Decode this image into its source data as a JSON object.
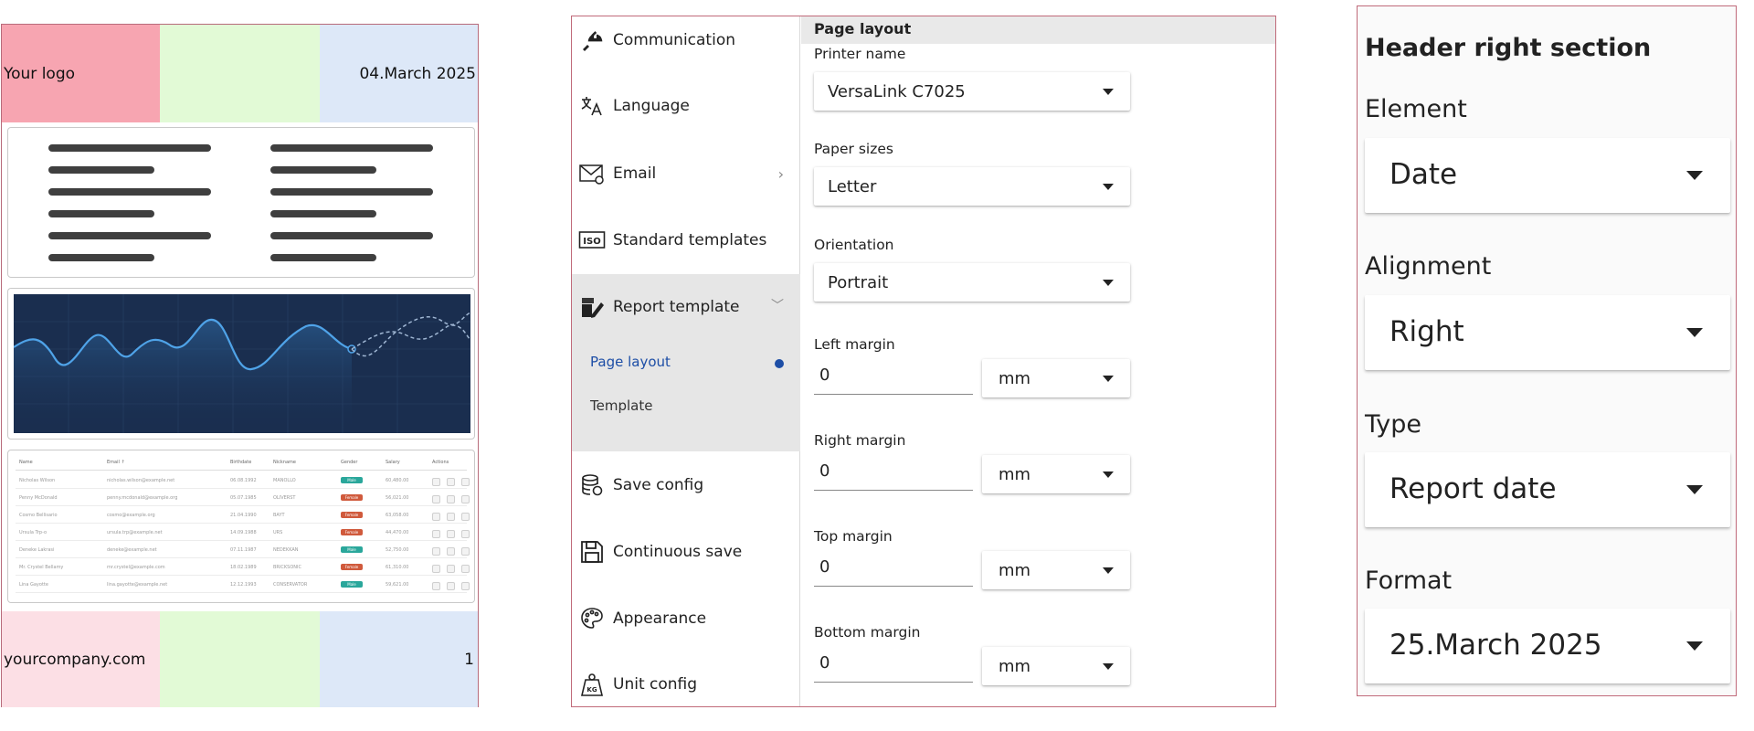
{
  "preview": {
    "header": {
      "logo": "Your logo",
      "date": "04.March 2025"
    },
    "footer": {
      "url": "yourcompany.com",
      "page": "1"
    },
    "colors": {
      "red": "#f7a5b1",
      "green": "#e2fad6",
      "blue": "#dde8f8",
      "footer_red": "#fcdfe5",
      "chart_bg": "#1a2e4f"
    },
    "table": {
      "headers": [
        "Name",
        "Email ↑",
        "Birthdate",
        "Nickname",
        "Gender",
        "Salary",
        "Actions"
      ],
      "rows": [
        {
          "name": "Nicholas Wilson",
          "email": "nicholas.wilson@example.net",
          "birth": "06.08.1992",
          "nick": "MANOLLO",
          "gender": "Male",
          "salary": "60,480.00"
        },
        {
          "name": "Penny McDonald",
          "email": "penny.mcdonald@example.org",
          "birth": "05.07.1985",
          "nick": "OLIVERST",
          "gender": "Female",
          "salary": "56,021.00"
        },
        {
          "name": "Cosmo Bellisario",
          "email": "cosmo@example.org",
          "birth": "21.04.1990",
          "nick": "BAYT",
          "gender": "Female",
          "salary": "63,058.00"
        },
        {
          "name": "Ursula Trp-o",
          "email": "ursula.trp@example.net",
          "birth": "14.09.1988",
          "nick": "URS",
          "gender": "Female",
          "salary": "44,470.00"
        },
        {
          "name": "Deneke Lakrasi",
          "email": "deneke@example.net",
          "birth": "07.11.1987",
          "nick": "NEDEKKAN",
          "gender": "Male",
          "salary": "52,750.00"
        },
        {
          "name": "Mr. Crystel Bellamy",
          "email": "mr.crystel@example.com",
          "birth": "18.02.1989",
          "nick": "BRICKSONIC",
          "gender": "Female",
          "salary": "61,310.00"
        },
        {
          "name": "Lina Gayotte",
          "email": "lina.gayotte@example.net",
          "birth": "12.12.1993",
          "nick": "CONSERVATOR",
          "gender": "Male",
          "salary": "59,621.00"
        }
      ]
    }
  },
  "nav": {
    "items": [
      {
        "label": "Communication",
        "icon": "plug-icon"
      },
      {
        "label": "Language",
        "icon": "translate-icon"
      },
      {
        "label": "Email",
        "icon": "email-icon"
      },
      {
        "label": "Standard templates",
        "icon": "iso-icon"
      },
      {
        "label": "Report template",
        "icon": "report-edit-icon"
      },
      {
        "label": "Save config",
        "icon": "database-icon"
      },
      {
        "label": "Continuous save",
        "icon": "floppy-icon"
      },
      {
        "label": "Appearance",
        "icon": "palette-icon"
      },
      {
        "label": "Unit config",
        "icon": "weight-icon"
      }
    ],
    "sub": {
      "page_layout": "Page layout",
      "template": "Template"
    },
    "accent": "#1d4ea6",
    "sub_bg": "#e6e6e6"
  },
  "form": {
    "title": "Page layout",
    "printer_label": "Printer name",
    "printer_value": "VersaLink C7025",
    "paper_label": "Paper sizes",
    "paper_value": "Letter",
    "orientation_label": "Orientation",
    "orientation_value": "Portrait",
    "left_label": "Left margin",
    "left_value": "0",
    "right_label": "Right margin",
    "right_value": "0",
    "top_label": "Top margin",
    "top_value": "0",
    "bottom_label": "Bottom margin",
    "bottom_value": "0",
    "unit": "mm"
  },
  "header_right": {
    "title": "Header right section",
    "element_label": "Element",
    "element_value": "Date",
    "alignment_label": "Alignment",
    "alignment_value": "Right",
    "type_label": "Type",
    "type_value": "Report date",
    "format_label": "Format",
    "format_value": "25.March 2025"
  }
}
